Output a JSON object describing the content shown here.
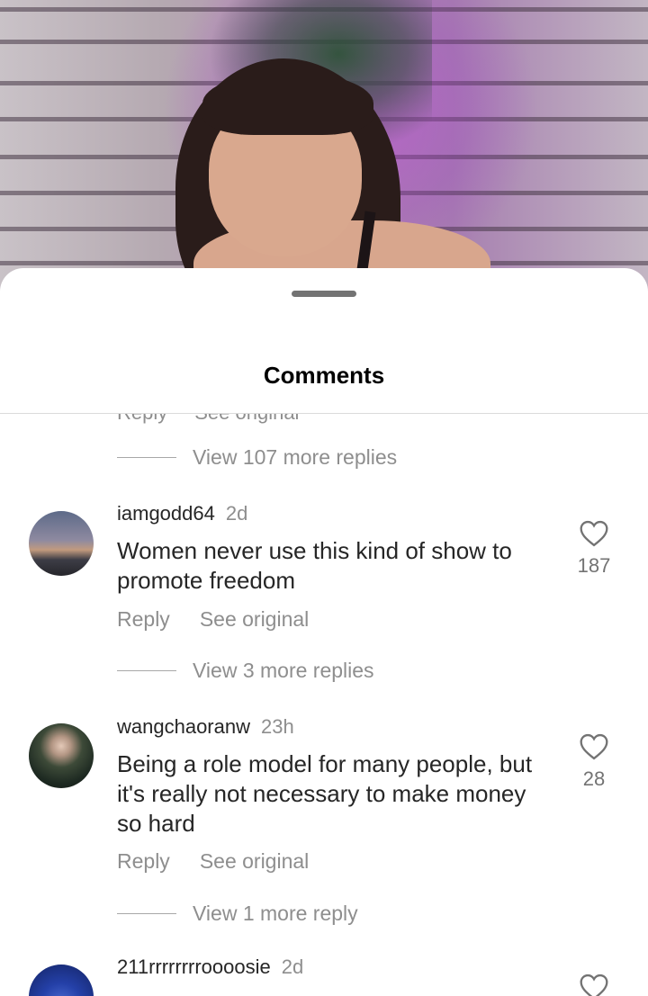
{
  "sheet": {
    "title": "Comments",
    "clipped_reply": "Reply",
    "clipped_see_original": "See original"
  },
  "thread_top": {
    "view_more": "View 107 more replies"
  },
  "comments": [
    {
      "username": "iamgodd64",
      "time": "2d",
      "text": "Women never use this kind of show to promote freedom",
      "reply_label": "Reply",
      "see_original_label": "See original",
      "likes": "187",
      "view_more": "View 3 more replies"
    },
    {
      "username": "wangchaoranw",
      "time": "23h",
      "text": "Being a role model for many people, but it's really not necessary to make money so hard",
      "reply_label": "Reply",
      "see_original_label": "See original",
      "likes": "28",
      "view_more": "View 1 more reply"
    },
    {
      "username": "211rrrrrrrroooosie",
      "time": "2d"
    }
  ],
  "icons": {
    "like": "heart-icon",
    "sheet_handle": "drag-handle"
  },
  "colors": {
    "secondary_text": "#8e8e8e",
    "primary_text": "#262626",
    "divider": "#dbdbdb"
  }
}
